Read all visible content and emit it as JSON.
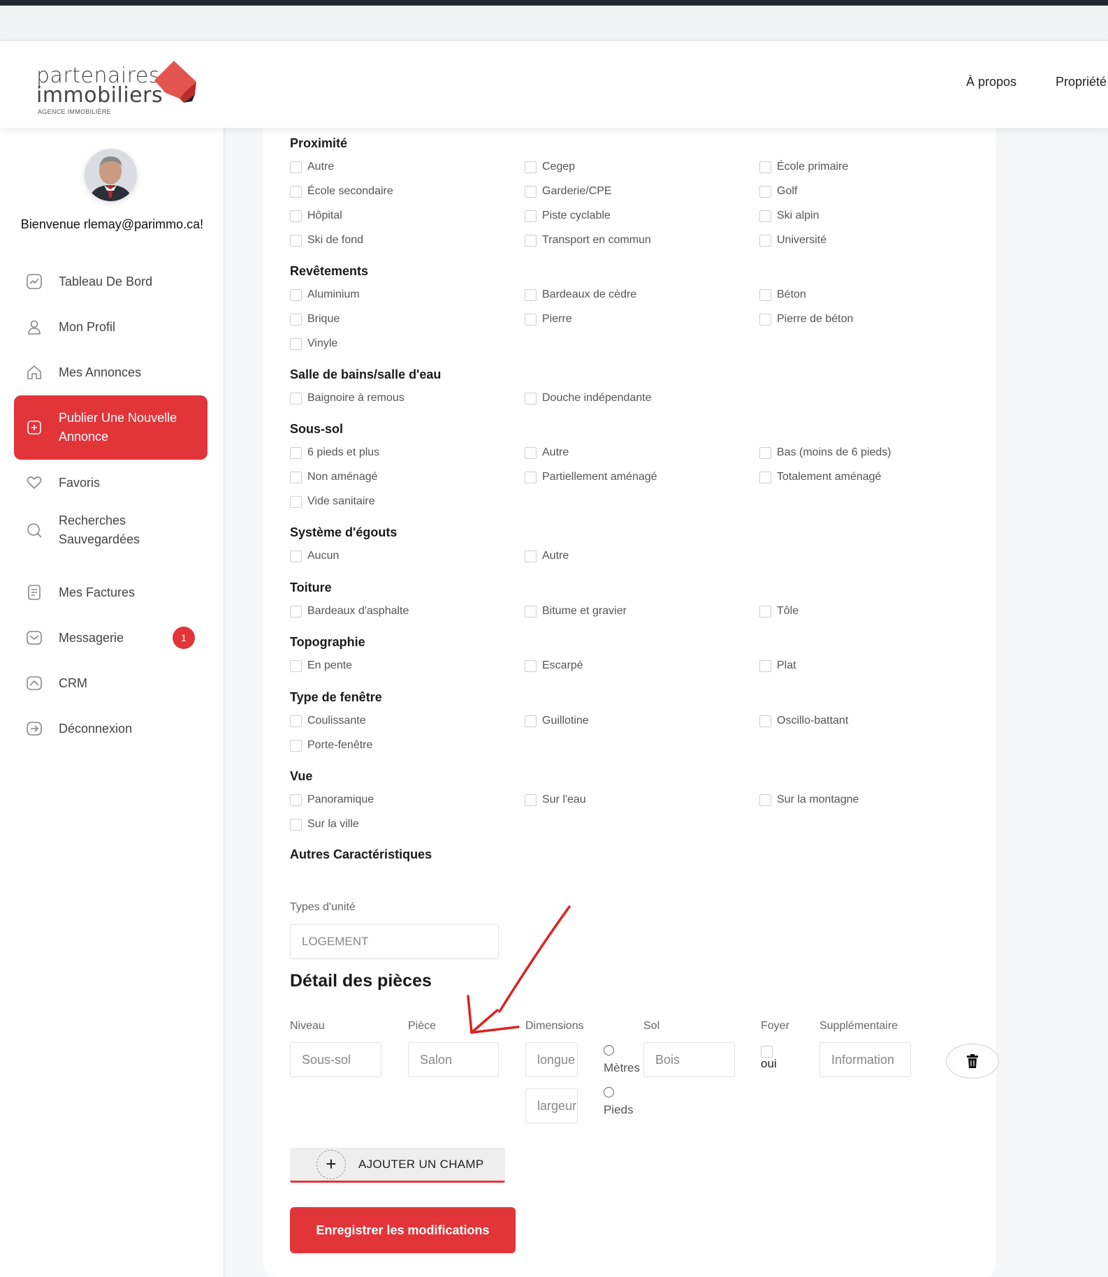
{
  "header": {
    "logo_line1": "partenaires",
    "logo_line2": "immobiliers",
    "logo_tagline": "AGENCE IMMOBILIÈRE",
    "nav": [
      "À propos",
      "Propriété"
    ],
    "brand_color": "#e1353a"
  },
  "sidebar": {
    "welcome": "Bienvenue rlemay@parimmo.ca!",
    "items": [
      {
        "label": "Tableau De Bord",
        "icon": "dashboard-icon"
      },
      {
        "label": "Mon Profil",
        "icon": "user-icon"
      },
      {
        "label": "Mes Annonces",
        "icon": "home-icon"
      },
      {
        "label": "Publier Une Nouvelle Annonce",
        "icon": "plus-square-icon",
        "active": true
      },
      {
        "label": "Favoris",
        "icon": "heart-icon"
      },
      {
        "label": "Recherches Sauvegardées",
        "icon": "search-icon"
      },
      {
        "label": "Mes Factures",
        "icon": "invoice-icon"
      },
      {
        "label": "Messagerie",
        "icon": "mail-icon",
        "badge": "1"
      },
      {
        "label": "CRM",
        "icon": "crm-icon"
      },
      {
        "label": "Déconnexion",
        "icon": "logout-icon"
      }
    ]
  },
  "sections": [
    {
      "title": "Proximité",
      "options": [
        "Autre",
        "Cegep",
        "École primaire",
        "École secondaire",
        "Garderie/CPE",
        "Golf",
        "Hôpital",
        "Piste cyclable",
        "Ski alpin",
        "Ski de fond",
        "Transport en commun",
        "Université"
      ]
    },
    {
      "title": "Revêtements",
      "options": [
        "Aluminium",
        "Bardeaux de cèdre",
        "Béton",
        "Brique",
        "Pierre",
        "Pierre de béton",
        "Vinyle"
      ]
    },
    {
      "title": "Salle de bains/salle d'eau",
      "options": [
        "Baignoire à remous",
        "Douche indépendante"
      ]
    },
    {
      "title": "Sous-sol",
      "options": [
        "6 pieds et plus",
        "Autre",
        "Bas (moins de 6 pieds)",
        "Non aménagé",
        "Partiellement aménagé",
        "Totalement aménagé",
        "Vide sanitaire"
      ]
    },
    {
      "title": "Système d'égouts",
      "options": [
        "Aucun",
        "Autre"
      ]
    },
    {
      "title": "Toiture",
      "options": [
        "Bardeaux d'asphalte",
        "Bitume et gravier",
        "Tôle"
      ]
    },
    {
      "title": "Topographie",
      "options": [
        "En pente",
        "Escarpé",
        "Plat"
      ]
    },
    {
      "title": "Type de fenêtre",
      "options": [
        "Coulissante",
        "Guillotine",
        "Oscillo-battant",
        "Porte-fenêtre"
      ]
    },
    {
      "title": "Vue",
      "options": [
        "Panoramique",
        "Sur l'eau",
        "Sur la montagne",
        "Sur la ville"
      ]
    }
  ],
  "autres": {
    "title": "Autres Caractéristiques",
    "unit_label": "Types d'unité",
    "unit_value": "LOGEMENT"
  },
  "rooms": {
    "title": "Détail des pièces",
    "headers": {
      "niveau": "Niveau",
      "piece": "Pièce",
      "dimensions": "Dimensions",
      "sol": "Sol",
      "foyer": "Foyer",
      "supp": "Supplémentaire"
    },
    "row": {
      "niveau": "Sous-sol",
      "piece": "Salon",
      "longueur": "longue",
      "largeur": "largeur",
      "unit_m": "Mètres",
      "unit_p": "Pieds",
      "sol": "Bois",
      "foyer": "oui",
      "supp": "Information"
    }
  },
  "buttons": {
    "add_field": "AJOUTER UN CHAMP",
    "save": "Enregistrer les modifications"
  }
}
